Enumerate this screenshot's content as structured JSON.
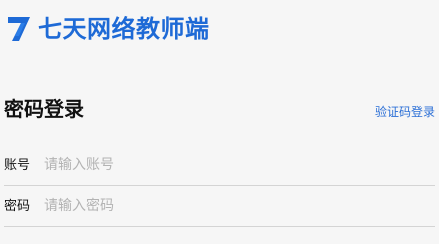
{
  "brand": {
    "icon": "seven-logo-icon",
    "name": "七天网络教师端",
    "color": "#1e6ad6"
  },
  "login": {
    "title": "密码登录",
    "switch_link": "验证码登录",
    "account": {
      "label": "账号",
      "placeholder": "请输入账号",
      "value": ""
    },
    "password": {
      "label": "密码",
      "placeholder": "请输入密码",
      "value": ""
    }
  },
  "colors": {
    "link": "#2b6fd6",
    "background": "#f6f6f6",
    "placeholder": "#b3b3b3"
  }
}
